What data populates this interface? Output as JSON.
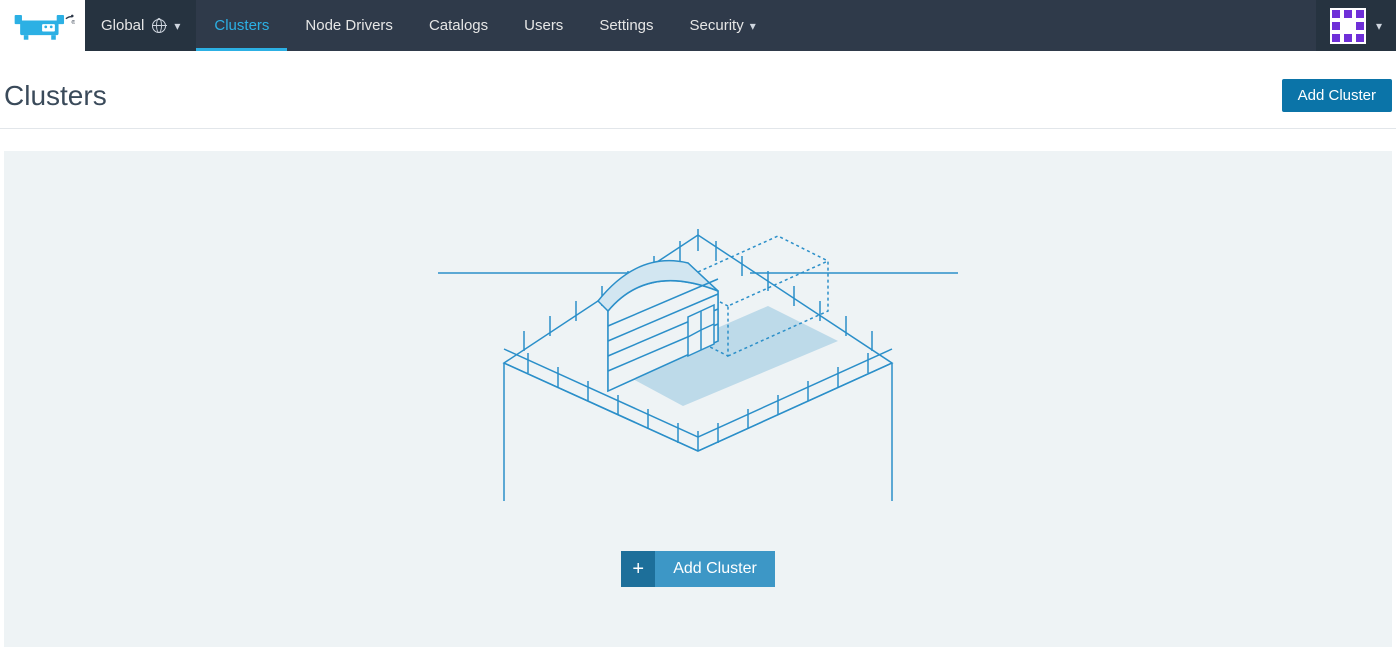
{
  "scope": {
    "label": "Global"
  },
  "nav": {
    "items": [
      {
        "label": "Clusters",
        "active": true,
        "dropdown": false
      },
      {
        "label": "Node Drivers",
        "active": false,
        "dropdown": false
      },
      {
        "label": "Catalogs",
        "active": false,
        "dropdown": false
      },
      {
        "label": "Users",
        "active": false,
        "dropdown": false
      },
      {
        "label": "Settings",
        "active": false,
        "dropdown": false
      },
      {
        "label": "Security",
        "active": false,
        "dropdown": true
      }
    ]
  },
  "page": {
    "title": "Clusters",
    "add_button_label": "Add Cluster"
  },
  "empty_state": {
    "cta_label": "Add Cluster",
    "cta_icon": "+"
  },
  "colors": {
    "accent": "#2cb0e4",
    "topbar": "#2f3a4a",
    "panel": "#eef3f5",
    "primary_btn": "#0b74a8",
    "avatar_accent": "#6f2fd8"
  }
}
